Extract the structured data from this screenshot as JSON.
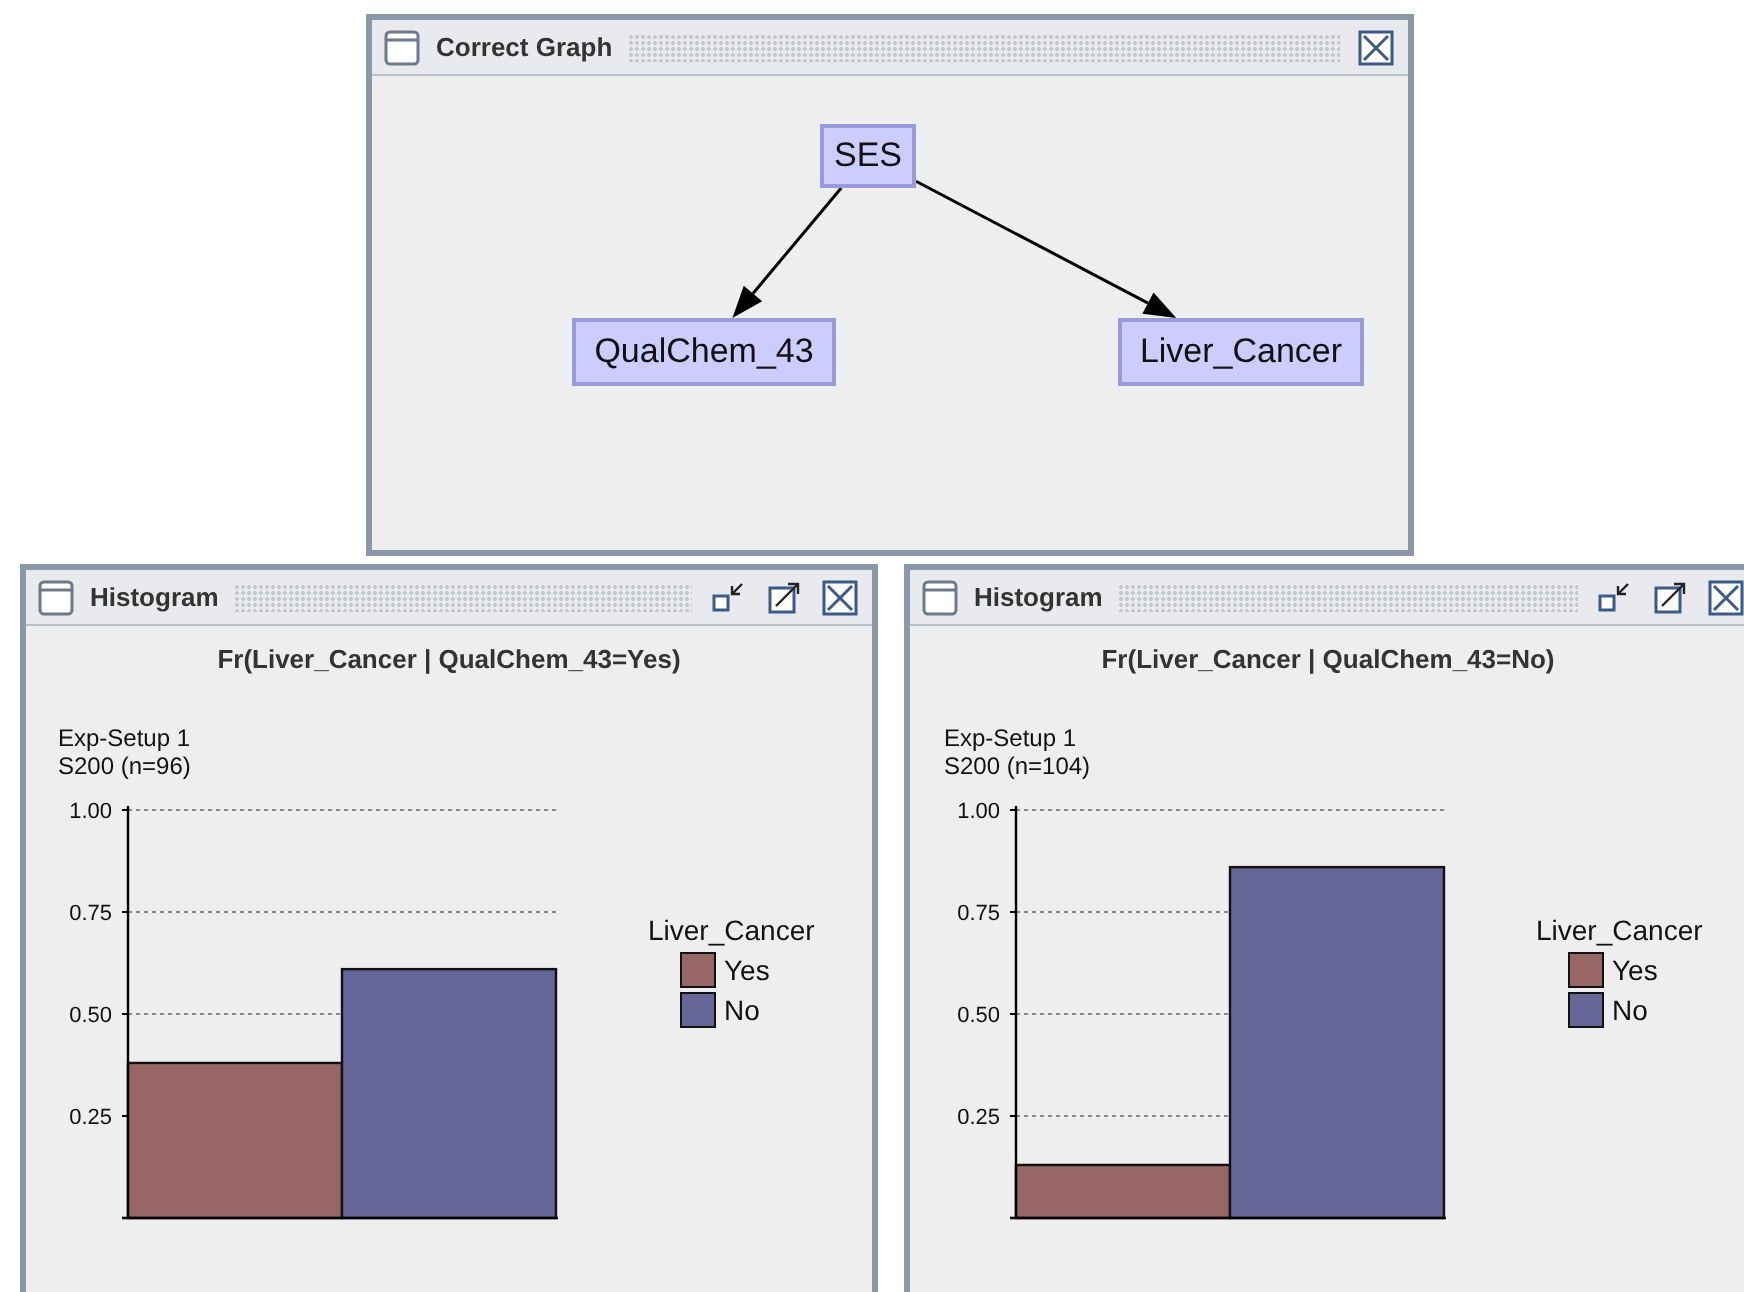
{
  "graph_window": {
    "title": "Correct Graph",
    "nodes": [
      {
        "label": "SES",
        "children": [
          {
            "label": "QualChem_43"
          },
          {
            "label": "Liver_Cancer"
          }
        ]
      }
    ]
  },
  "histogram_windows": [
    {
      "title": "Histogram",
      "plot_title": "Fr(Liver_Cancer | QualChem_43=Yes)",
      "subtitle_lines": [
        "Exp-Setup 1",
        "S200 (n=96)"
      ],
      "legend_title": "Liver_Cancer",
      "chart_data": {
        "type": "bar",
        "grid": true,
        "ylim": [
          0,
          1
        ],
        "yticks": [
          {
            "value": 0.25,
            "label": "0.25"
          },
          {
            "value": 0.5,
            "label": "0.50"
          },
          {
            "value": 0.75,
            "label": "0.75"
          },
          {
            "value": 1,
            "label": "1.00"
          }
        ],
        "series": [
          {
            "name": "Yes",
            "color": "#996666",
            "values": [
              0.38
            ]
          },
          {
            "name": "No",
            "color": "#666699",
            "values": [
              0.61
            ]
          }
        ]
      }
    },
    {
      "title": "Histogram",
      "plot_title": "Fr(Liver_Cancer | QualChem_43=No)",
      "subtitle_lines": [
        "Exp-Setup 1",
        "S200 (n=104)"
      ],
      "legend_title": "Liver_Cancer",
      "chart_data": {
        "type": "bar",
        "grid": true,
        "ylim": [
          0,
          1
        ],
        "yticks": [
          {
            "value": 0.25,
            "label": "0.25"
          },
          {
            "value": 0.5,
            "label": "0.50"
          },
          {
            "value": 0.75,
            "label": "0.75"
          },
          {
            "value": 1,
            "label": "1.00"
          }
        ],
        "series": [
          {
            "name": "Yes",
            "color": "#996666",
            "values": [
              0.13
            ]
          },
          {
            "name": "No",
            "color": "#666699",
            "values": [
              0.86
            ]
          }
        ]
      }
    }
  ]
}
